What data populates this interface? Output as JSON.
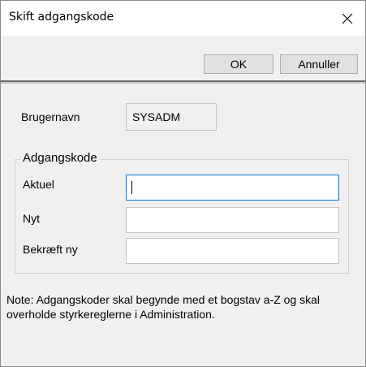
{
  "window": {
    "title": "Skift adgangskode",
    "close_icon": "close-icon"
  },
  "toolbar": {
    "ok_label": "OK",
    "cancel_label": "Annuller"
  },
  "form": {
    "username_label": "Brugernavn",
    "username_value": "SYSADM",
    "group_title": "Adgangskode",
    "current_label": "Aktuel",
    "current_value": "",
    "new_label": "Nyt",
    "new_value": "",
    "confirm_label": "Bekræft ny",
    "confirm_value": ""
  },
  "note": "Note: Adgangskoder skal begynde med et bogstav a-Z og skal overholde styrkereglerne i Administration.",
  "colors": {
    "background": "#f0f0f0",
    "titlebar": "#ffffff",
    "focus_border": "#0078d7"
  }
}
